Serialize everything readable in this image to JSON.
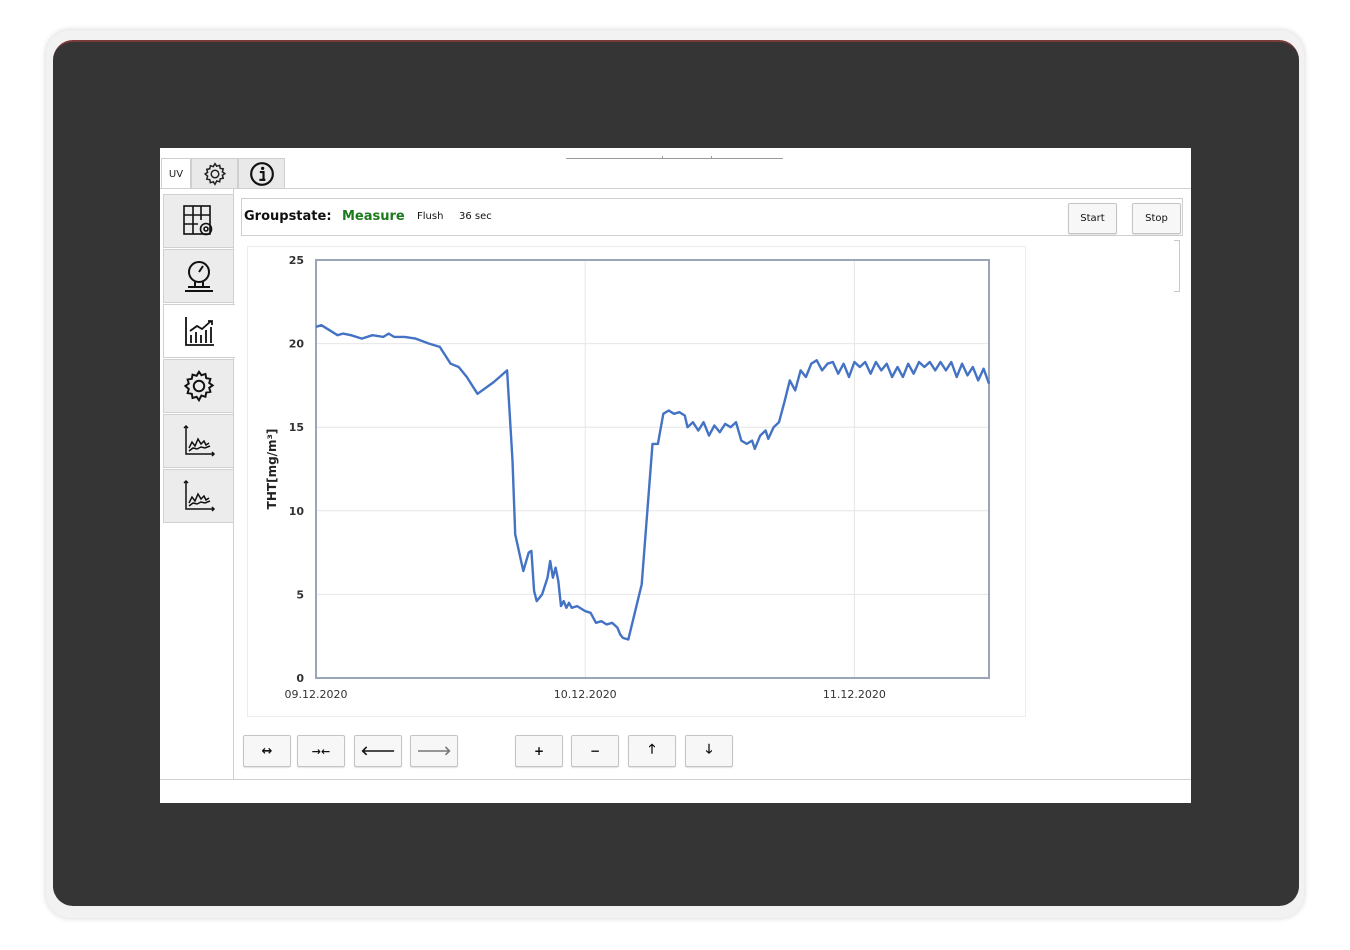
{
  "tabs": {
    "uv_label": "UV",
    "settings_icon": "gear-icon",
    "info_icon": "info-icon"
  },
  "sidebar": {
    "items": [
      {
        "icon": "table-settings-icon"
      },
      {
        "icon": "gauge-icon"
      },
      {
        "icon": "bar-chart-trend-icon"
      },
      {
        "icon": "gear-icon"
      },
      {
        "icon": "line-chart-icon"
      },
      {
        "icon": "line-chart-icon"
      }
    ]
  },
  "status": {
    "groupstate_label": "Groupstate:",
    "state_value": "Measure",
    "state_color": "#1d7a1d",
    "phase": "Flush",
    "remaining": "36 sec"
  },
  "controls": {
    "start_label": "Start",
    "stop_label": "Stop"
  },
  "nav": {
    "expand_icon": "expand-horizontal-icon",
    "compress_icon": "compress-horizontal-icon",
    "left_icon": "arrow-left-icon",
    "right_icon": "arrow-right-icon",
    "zoom_in_icon": "plus-icon",
    "zoom_out_icon": "minus-icon",
    "up_icon": "arrow-up-icon",
    "down_icon": "arrow-down-icon"
  },
  "chart_data": {
    "type": "line",
    "title": "",
    "xlabel": "",
    "ylabel": "THT[mg/m³]",
    "ylim": [
      0,
      25
    ],
    "yticks": [
      "0",
      "5",
      "10",
      "15",
      "20",
      "25"
    ],
    "xticks": [
      "09.12.2020",
      "10.12.2020",
      "11.12.2020"
    ],
    "xlim_days": [
      0,
      2.5
    ],
    "grid": true,
    "line_color": "#4472c4",
    "series": [
      {
        "points": [
          [
            0.0,
            21.0
          ],
          [
            0.02,
            21.1
          ],
          [
            0.05,
            20.8
          ],
          [
            0.08,
            20.5
          ],
          [
            0.1,
            20.6
          ],
          [
            0.13,
            20.5
          ],
          [
            0.17,
            20.3
          ],
          [
            0.21,
            20.5
          ],
          [
            0.25,
            20.4
          ],
          [
            0.27,
            20.6
          ],
          [
            0.29,
            20.4
          ],
          [
            0.33,
            20.4
          ],
          [
            0.37,
            20.3
          ],
          [
            0.42,
            20.0
          ],
          [
            0.46,
            19.8
          ],
          [
            0.5,
            18.8
          ],
          [
            0.53,
            18.6
          ],
          [
            0.56,
            18.0
          ],
          [
            0.6,
            17.0
          ],
          [
            0.66,
            17.7
          ],
          [
            0.71,
            18.4
          ],
          [
            0.73,
            13.0
          ],
          [
            0.74,
            8.6
          ],
          [
            0.77,
            6.4
          ],
          [
            0.79,
            7.5
          ],
          [
            0.8,
            7.6
          ],
          [
            0.81,
            5.2
          ],
          [
            0.82,
            4.6
          ],
          [
            0.84,
            5.0
          ],
          [
            0.86,
            6.0
          ],
          [
            0.87,
            7.0
          ],
          [
            0.88,
            6.0
          ],
          [
            0.89,
            6.6
          ],
          [
            0.9,
            5.8
          ],
          [
            0.91,
            4.3
          ],
          [
            0.92,
            4.6
          ],
          [
            0.93,
            4.2
          ],
          [
            0.94,
            4.5
          ],
          [
            0.95,
            4.2
          ],
          [
            0.97,
            4.3
          ],
          [
            1.0,
            4.0
          ],
          [
            1.02,
            3.9
          ],
          [
            1.04,
            3.3
          ],
          [
            1.06,
            3.4
          ],
          [
            1.08,
            3.2
          ],
          [
            1.1,
            3.3
          ],
          [
            1.12,
            3.0
          ],
          [
            1.13,
            2.6
          ],
          [
            1.14,
            2.4
          ],
          [
            1.16,
            2.3
          ],
          [
            1.21,
            5.6
          ],
          [
            1.25,
            14.0
          ],
          [
            1.27,
            14.0
          ],
          [
            1.29,
            15.8
          ],
          [
            1.31,
            16.0
          ],
          [
            1.33,
            15.8
          ],
          [
            1.35,
            15.9
          ],
          [
            1.37,
            15.7
          ],
          [
            1.38,
            15.0
          ],
          [
            1.4,
            15.3
          ],
          [
            1.42,
            14.8
          ],
          [
            1.44,
            15.3
          ],
          [
            1.46,
            14.5
          ],
          [
            1.48,
            15.1
          ],
          [
            1.5,
            14.7
          ],
          [
            1.52,
            15.2
          ],
          [
            1.54,
            15.0
          ],
          [
            1.56,
            15.3
          ],
          [
            1.58,
            14.2
          ],
          [
            1.6,
            14.0
          ],
          [
            1.62,
            14.2
          ],
          [
            1.63,
            13.7
          ],
          [
            1.65,
            14.5
          ],
          [
            1.67,
            14.8
          ],
          [
            1.68,
            14.3
          ],
          [
            1.7,
            15.0
          ],
          [
            1.72,
            15.3
          ],
          [
            1.74,
            16.5
          ],
          [
            1.76,
            17.8
          ],
          [
            1.78,
            17.2
          ],
          [
            1.8,
            18.4
          ],
          [
            1.82,
            18.0
          ],
          [
            1.84,
            18.8
          ],
          [
            1.86,
            19.0
          ],
          [
            1.88,
            18.4
          ],
          [
            1.9,
            18.8
          ],
          [
            1.92,
            18.9
          ],
          [
            1.94,
            18.2
          ],
          [
            1.96,
            18.8
          ],
          [
            1.98,
            18.0
          ],
          [
            2.0,
            18.9
          ],
          [
            2.02,
            18.6
          ],
          [
            2.04,
            18.9
          ],
          [
            2.06,
            18.2
          ],
          [
            2.08,
            18.9
          ],
          [
            2.1,
            18.4
          ],
          [
            2.12,
            18.8
          ],
          [
            2.14,
            18.0
          ],
          [
            2.16,
            18.6
          ],
          [
            2.18,
            18.0
          ],
          [
            2.2,
            18.8
          ],
          [
            2.22,
            18.2
          ],
          [
            2.24,
            18.9
          ],
          [
            2.26,
            18.6
          ],
          [
            2.28,
            18.9
          ],
          [
            2.3,
            18.4
          ],
          [
            2.32,
            18.9
          ],
          [
            2.34,
            18.4
          ],
          [
            2.36,
            18.9
          ],
          [
            2.38,
            18.0
          ],
          [
            2.4,
            18.8
          ],
          [
            2.42,
            18.1
          ],
          [
            2.44,
            18.6
          ],
          [
            2.46,
            17.8
          ],
          [
            2.48,
            18.5
          ],
          [
            2.5,
            17.6
          ]
        ]
      }
    ]
  }
}
